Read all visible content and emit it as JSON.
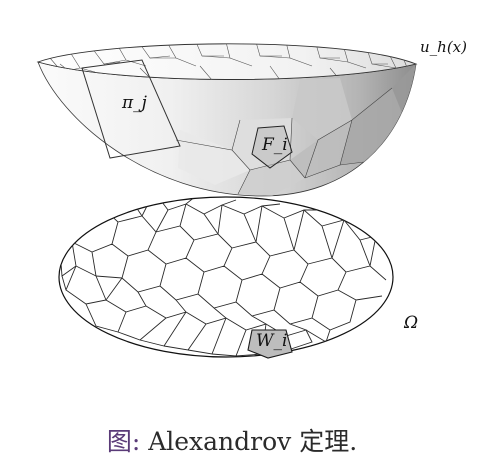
{
  "figure": {
    "labels": {
      "surface": "u_h(x)",
      "plane": "π_j",
      "face": "F_i",
      "domain": "Ω",
      "cell": "W_i"
    }
  },
  "caption": {
    "prefix": "图:",
    "text": "Alexandrov 定理."
  },
  "colors": {
    "stroke": "#222222",
    "surface_light": "#fafafa",
    "surface_dark": "#8a8a8a",
    "highlight_cell": "#bfbfbf",
    "caption_prefix": "#5a3b78"
  }
}
